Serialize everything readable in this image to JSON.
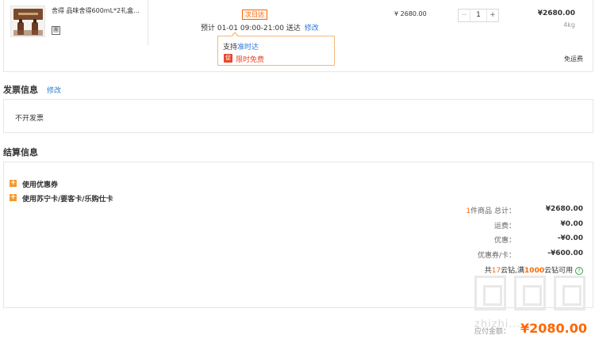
{
  "product": {
    "name": "舍得 品味舍得600mL*2礼盒...",
    "seal_icon": "團",
    "delivery_badge": "次日达",
    "delivery_estimate": "预计 01-01 09:00-21:00 送达",
    "modify_label": "修改",
    "unit_price": "¥ 2680.00",
    "quantity": "1",
    "minus_label": "−",
    "plus_label": "+",
    "subtotal": "¥2680.00",
    "weight": "4kg"
  },
  "popup": {
    "support_prefix": "支持",
    "support_link": "准时达",
    "promo_icon": "促",
    "promo_text": "限时免费"
  },
  "shipping": {
    "free_label": "免运费"
  },
  "invoice": {
    "title": "发票信息",
    "modify_label": "修改",
    "value": "不开发票"
  },
  "settlement": {
    "title": "结算信息",
    "coupon_label": "使用优惠券",
    "card_label": "使用苏宁卡/要客卡/乐购仕卡",
    "expand_icon": "+",
    "summary": {
      "items_count": "1",
      "items_label": "件商品 总计：",
      "items_value": "¥2680.00",
      "freight_label": "运费：",
      "freight_value": "¥0.00",
      "discount_label": "优惠：",
      "discount_value": "-¥0.00",
      "coupon_card_label": "优惠券/卡：",
      "coupon_card_value": "-¥600.00",
      "diamond_prefix": "共",
      "diamond_total": "17",
      "diamond_mid": "云钻,满",
      "diamond_threshold": "1000",
      "diamond_suffix": "云钻可用",
      "help_icon": "?"
    }
  },
  "total": {
    "label": "应付金额：",
    "value": "¥2080.00"
  },
  "watermark": {
    "text": "zhizhi..."
  },
  "colors": {
    "accent": "#ff6600",
    "link": "#2d7bd5",
    "border": "#e6e6e6",
    "popup_border": "#f7b77c",
    "help_green": "#3a9c4a"
  }
}
